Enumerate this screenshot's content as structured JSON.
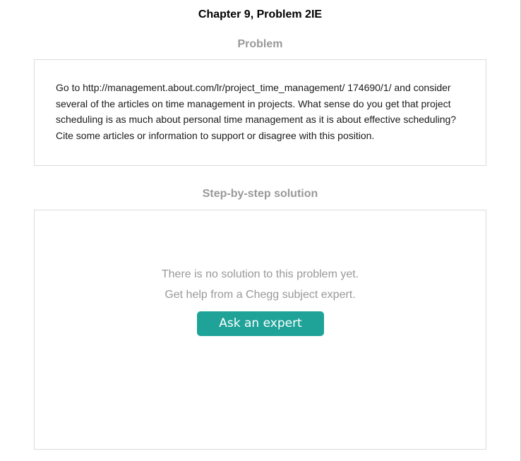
{
  "header": {
    "chapter_title": "Chapter 9, Problem 2IE"
  },
  "problem": {
    "heading": "Problem",
    "text": "Go to http://management.about.com/lr/project_time_management/ 174690/1/ and consider several of the articles on time management in projects. What sense do you get that project scheduling is as much about personal time management as it is about effective scheduling? Cite some articles or information to support or disagree with this position."
  },
  "solution": {
    "heading": "Step-by-step solution",
    "message_line1": "There is no solution to this problem yet.",
    "message_line2": "Get help from a Chegg subject expert.",
    "ask_button_label": "Ask an expert"
  },
  "colors": {
    "accent": "#1fa398",
    "muted_text": "#999999",
    "border": "#dcdcdc"
  }
}
